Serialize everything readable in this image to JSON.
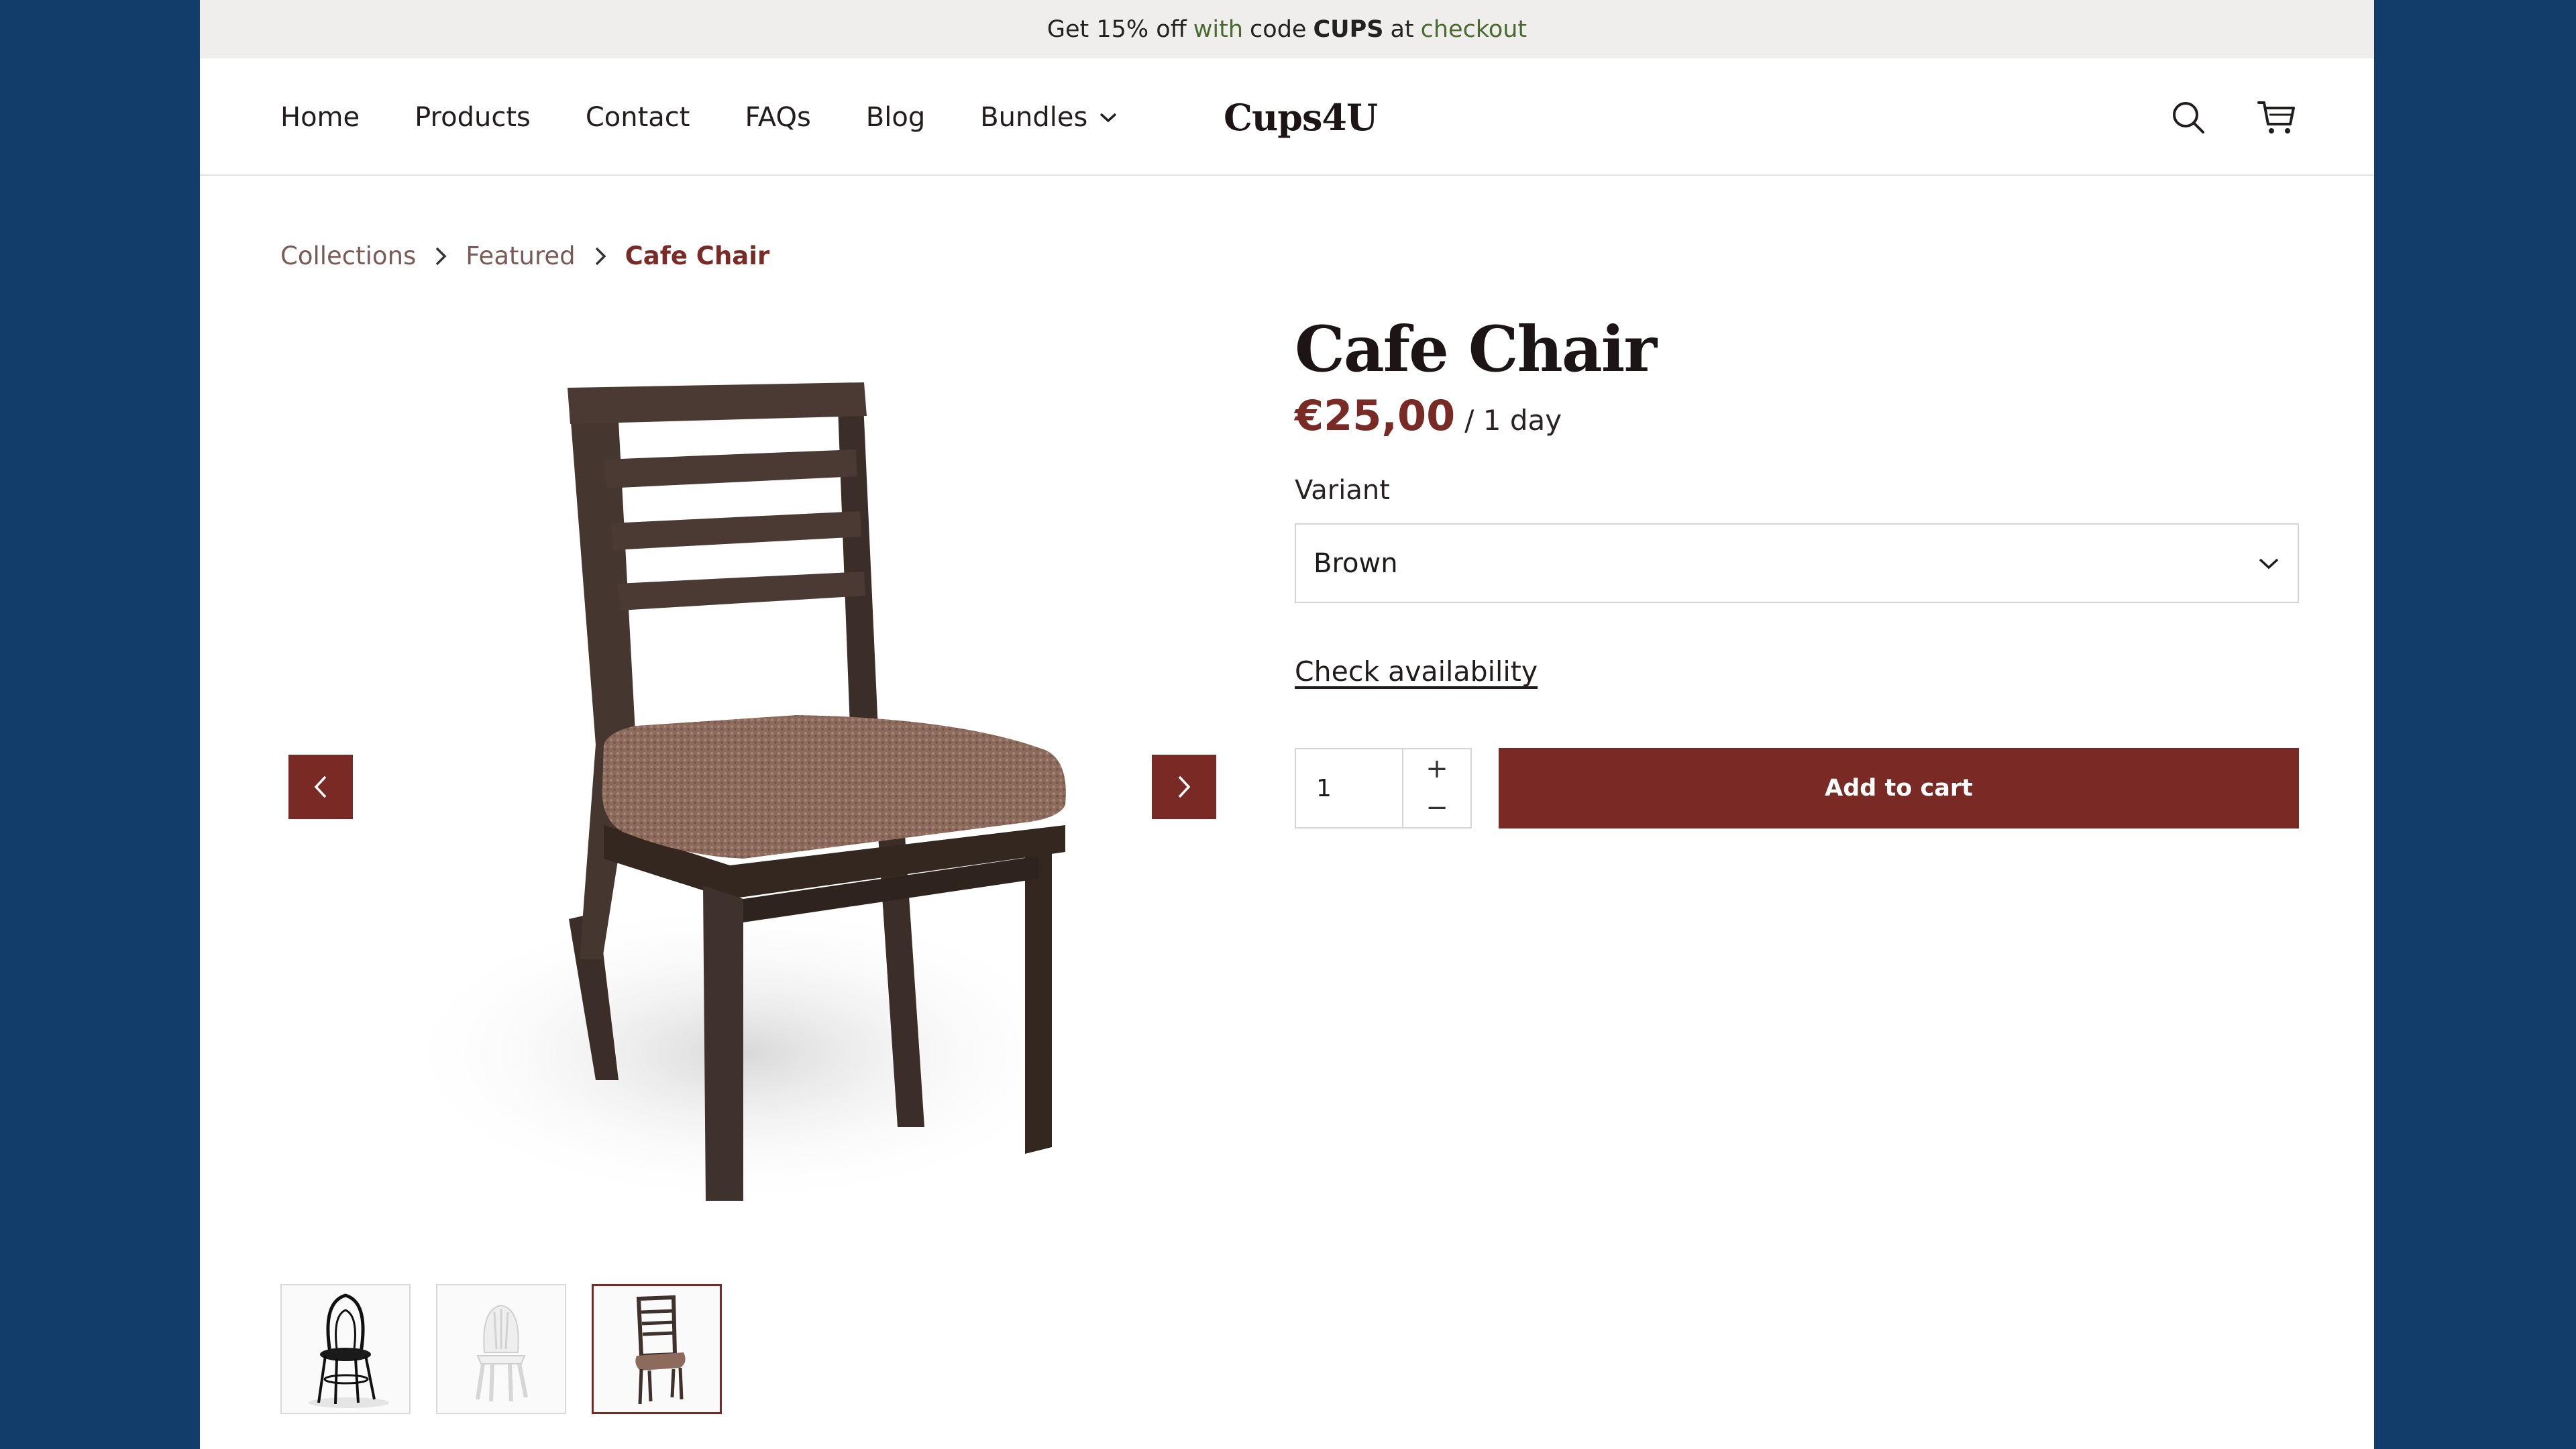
{
  "announcement": {
    "part1": "Get 15% off",
    "part2": "with",
    "part3": "code",
    "code": "CUPS",
    "part4": "at",
    "link": "checkout"
  },
  "nav": {
    "items": [
      {
        "label": "Home"
      },
      {
        "label": "Products"
      },
      {
        "label": "Contact"
      },
      {
        "label": "FAQs"
      },
      {
        "label": "Blog"
      },
      {
        "label": "Bundles"
      }
    ]
  },
  "brand": {
    "logo": "Cups4U"
  },
  "icons": {
    "search": "search-icon",
    "cart": "cart-icon",
    "dropdown": "chevron-down-icon",
    "prev": "chevron-left-icon",
    "next": "chevron-right-icon"
  },
  "breadcrumb": {
    "items": [
      "Collections",
      "Featured"
    ],
    "current": "Cafe Chair"
  },
  "product": {
    "title": "Cafe Chair",
    "price": "€25,00",
    "per": "/ 1 day",
    "variant_label": "Variant",
    "variant_value": "Brown",
    "check_availability": "Check availability",
    "quantity": "1",
    "plus": "+",
    "minus": "−",
    "add_to_cart": "Add to cart"
  },
  "colors": {
    "accent": "#7a2a25",
    "background": "#123d6a",
    "announce_bg": "#efeeed"
  }
}
